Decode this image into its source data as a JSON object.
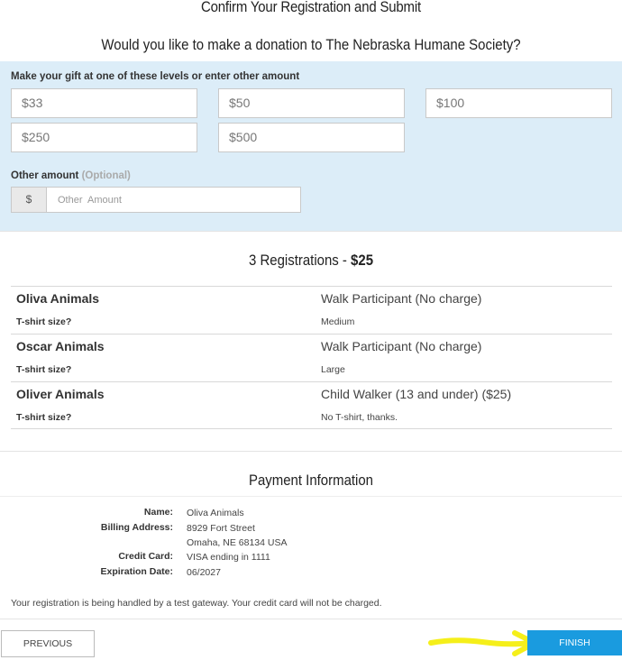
{
  "page": {
    "title": "Confirm Your Registration and Submit",
    "donation_question": "Would you like to make a donation to The Nebraska Humane Society?"
  },
  "donation": {
    "heading": "Make your gift at one of these levels or enter other amount",
    "levels": [
      "$33",
      "$50",
      "$100",
      "$250",
      "$500"
    ],
    "other_label": "Other amount",
    "other_optional": "(Optional)",
    "currency_symbol": "$",
    "other_placeholder": "Other  Amount"
  },
  "registrations": {
    "heading_prefix": "3 Registrations - ",
    "heading_total": "$25",
    "shirt_label": "T-shirt size?",
    "rows": [
      {
        "name": "Oliva Animals",
        "type": "Walk Participant (No charge)",
        "shirt": "Medium"
      },
      {
        "name": "Oscar Animals",
        "type": "Walk Participant (No charge)",
        "shirt": "Large"
      },
      {
        "name": "Oliver Animals",
        "type": "Child Walker (13 and under) ($25)",
        "shirt": "No T-shirt, thanks."
      }
    ]
  },
  "payment": {
    "heading": "Payment Information",
    "name_label": "Name:",
    "name_value": "Oliva Animals",
    "billing_label": "Billing Address:",
    "billing_line1": "8929 Fort Street",
    "billing_line2": "Omaha, NE 68134 USA",
    "card_label": "Credit Card:",
    "card_value": "VISA ending in 1111",
    "expiration_label": "Expiration Date:",
    "expiration_value": "06/2027",
    "gateway_note": "Your registration is being handled by a test gateway. Your credit card will not be charged."
  },
  "buttons": {
    "previous": "PREVIOUS",
    "finish": "FINISH"
  },
  "colors": {
    "panel_bg": "#dcedf8",
    "finish_bg": "#1a9bdf",
    "annotation": "#f5ef1a"
  }
}
